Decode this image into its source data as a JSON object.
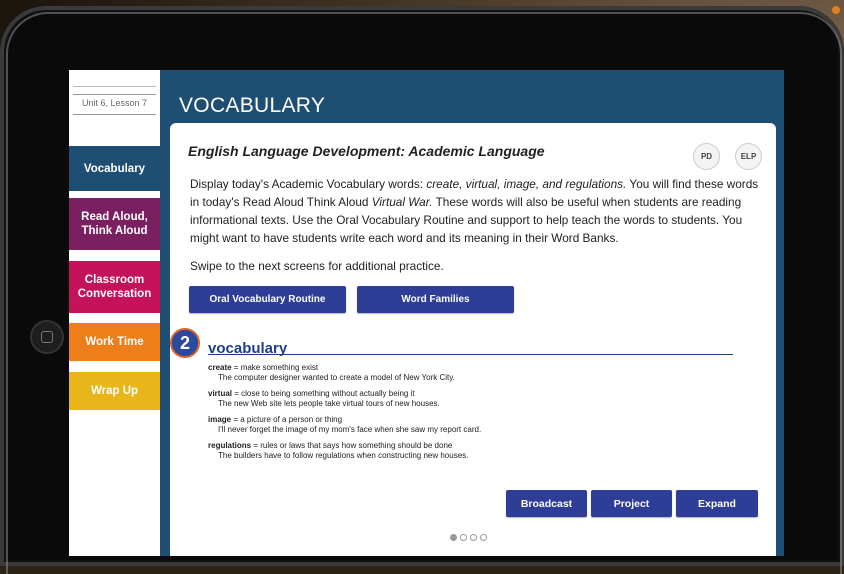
{
  "sidebar": {
    "unit_label": "Unit 6, Lesson 7",
    "items": [
      {
        "label": "Vocabulary",
        "color": "#1e4f73",
        "active": true
      },
      {
        "label": "Read Aloud, Think Aloud",
        "color": "#7a2060"
      },
      {
        "label": "Classroom Conversation",
        "color": "#c4135a"
      },
      {
        "label": "Work Time",
        "color": "#ee7e1a"
      },
      {
        "label": "Wrap Up",
        "color": "#e8b51a"
      }
    ]
  },
  "page_title": "VOCABULARY",
  "card": {
    "title": "English Language Development: Academic Language",
    "pills": {
      "pd": "PD",
      "elp": "ELP"
    },
    "body_pre": "Display today's Academic Vocabulary words: ",
    "body_words": "create, virtual, image, and regulations.",
    "body_mid": " You will find these words in today's Read Aloud Think Aloud ",
    "body_title": "Virtual War.",
    "body_post": " These words will also be useful when students are reading informational texts. Use the Oral Vocabulary Routine and support to help teach the words to students. You might want to have students write each word and its meaning in their Word Banks.",
    "swipe_text": "Swipe to the next screens for additional practice.",
    "buttons": {
      "oral": "Oral Vocabulary Routine",
      "families": "Word Families"
    },
    "badge_number": "2",
    "vocab_heading": "vocabulary",
    "vocab_entries": [
      {
        "word": "create",
        "definition": " = make something exist",
        "example": "The computer designer wanted to create a model of New York City."
      },
      {
        "word": "virtual",
        "definition": " = close to being something without actually being it",
        "example": "The new Web site lets people take virtual tours of new houses."
      },
      {
        "word": "image",
        "definition": " = a picture of a person or thing",
        "example": "I'll never forget the image of my mom's face when she saw my report card."
      },
      {
        "word": "regulations",
        "definition": " = rules or laws that says how something should be done",
        "example": "The builders have to follow regulations when constructing new houses."
      }
    ],
    "actions": {
      "broadcast": "Broadcast",
      "project": "Project",
      "expand": "Expand"
    },
    "pagination": {
      "total": 4,
      "current": 1
    }
  }
}
